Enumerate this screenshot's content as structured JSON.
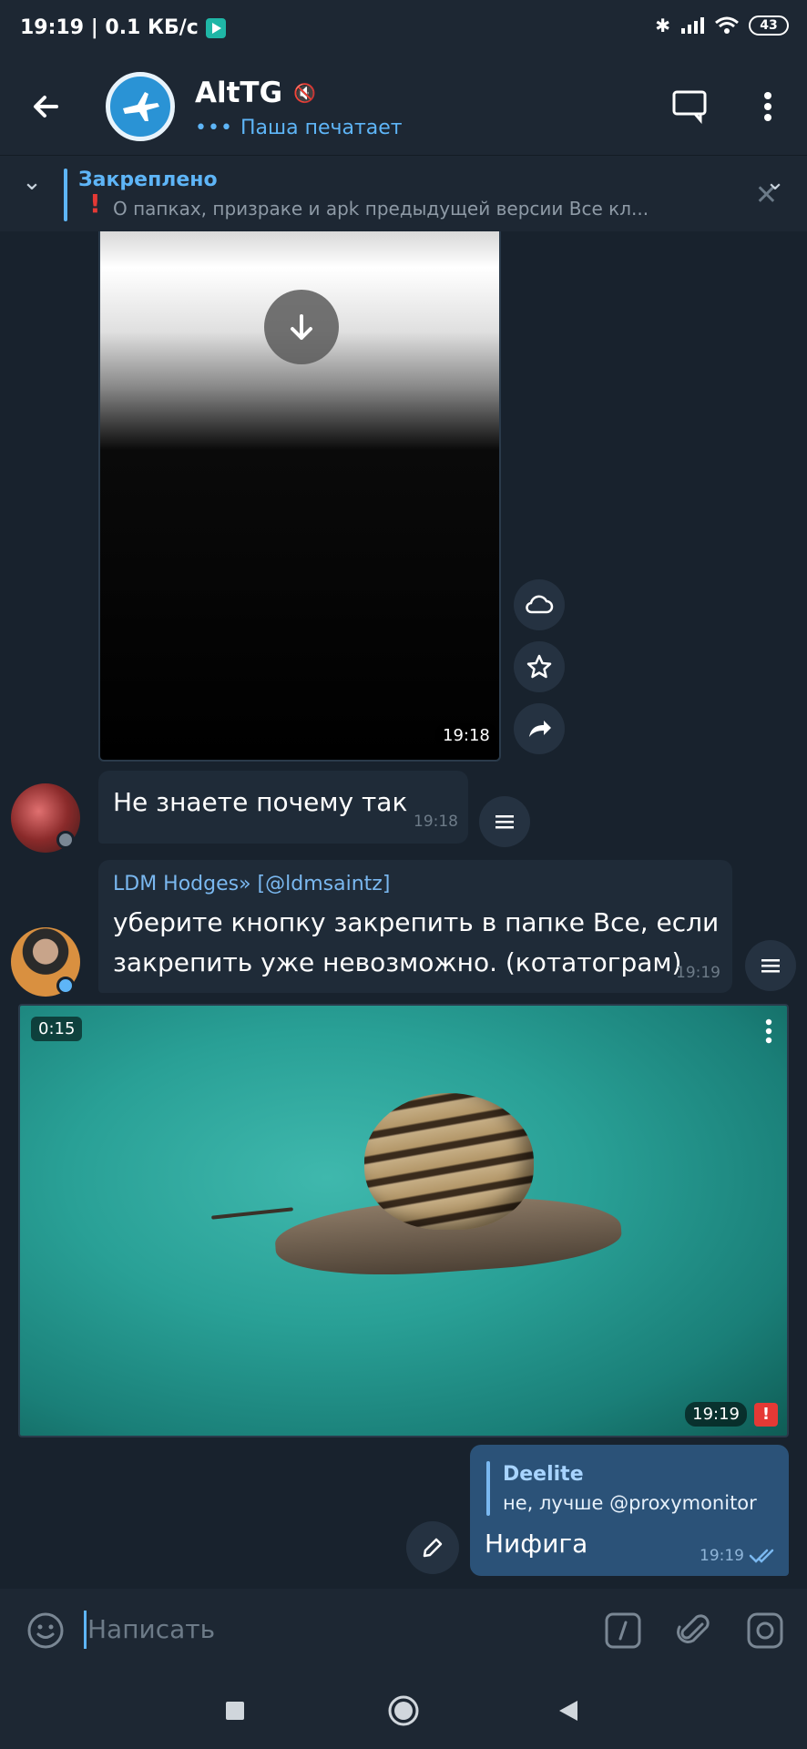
{
  "status_bar": {
    "time_speed": "19:19 | 0.1 КБ/с",
    "battery": "43"
  },
  "header": {
    "title": "AltTG",
    "typing_status": "Паша печатает"
  },
  "pinned": {
    "label": "Закреплено",
    "text": "О папках, призраке и apk предыдущей версии  Все кл..."
  },
  "messages": {
    "video1_time": "19:18",
    "msg1": {
      "text": "Не знаете почему так",
      "time": "19:18"
    },
    "msg2": {
      "forward_from": "LDM Hodges» [@ldmsaintz]",
      "line1": "уберите кнопку закрепить в папке Все, если",
      "line2": "закрепить уже невозможно. (котатограм)",
      "time": "19:19"
    },
    "video2": {
      "duration": "0:15",
      "time": "19:19"
    },
    "outgoing": {
      "reply_name": "Deelite",
      "reply_text": "не, лучше @proxymonitor",
      "text": "Нифига",
      "time": "19:19"
    }
  },
  "input": {
    "placeholder": "Написать"
  },
  "colors": {
    "accent": "#5eb5f7",
    "outgoing_bubble": "#2b5278",
    "incoming_bubble": "#1f2b38",
    "background": "#18222d",
    "error": "#e53935"
  }
}
